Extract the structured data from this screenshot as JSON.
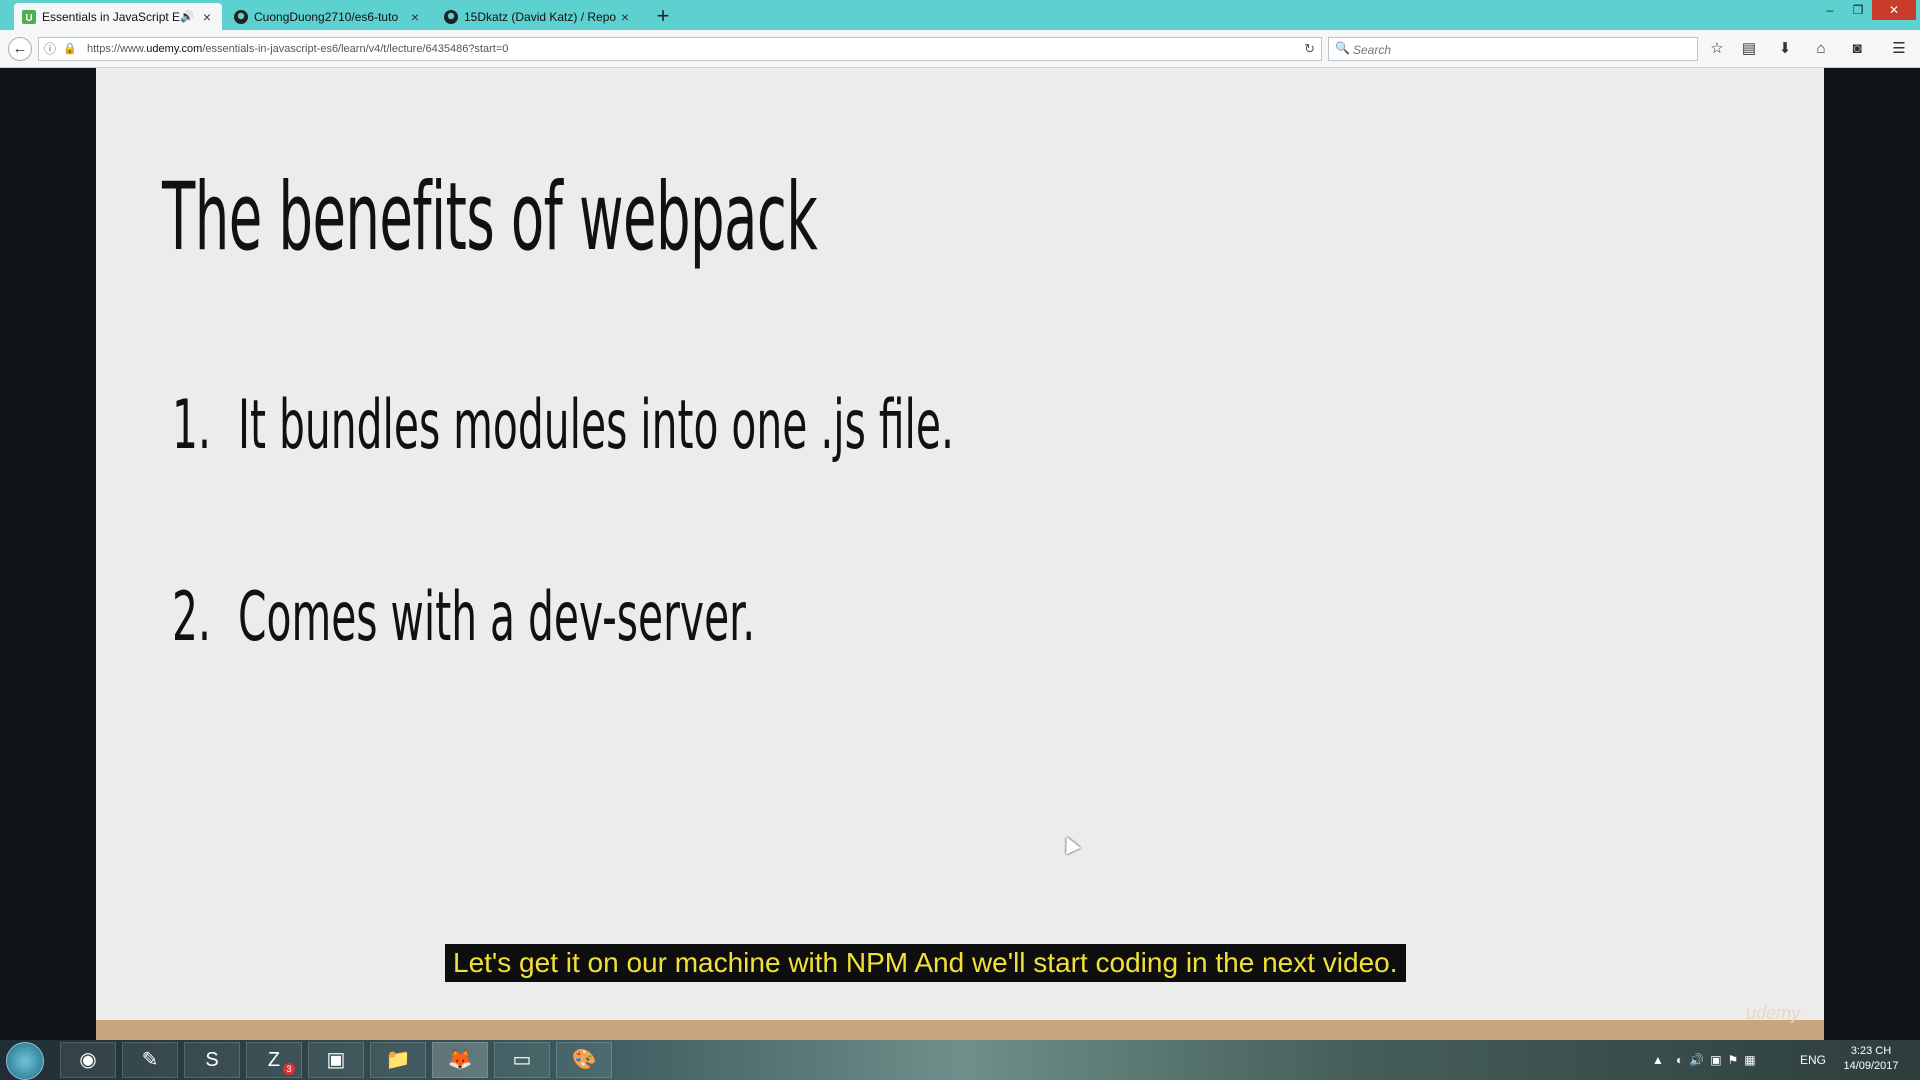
{
  "browser": {
    "tabs": [
      {
        "label": "Essentials in JavaScript ES",
        "active": true,
        "audio": true,
        "favicon": "udemy-icon"
      },
      {
        "label": "CuongDuong2710/es6-tuto",
        "active": false,
        "favicon": "github-icon"
      },
      {
        "label": "15Dkatz (David Katz) / Repo",
        "active": false,
        "favicon": "github-icon"
      }
    ],
    "url_prefix": "https://www.",
    "url_host": "udemy.com",
    "url_path": "/essentials-in-javascript-es6/learn/v4/t/lecture/6435486?start=0",
    "search_placeholder": "Search"
  },
  "slide": {
    "title": "The benefits of webpack",
    "items": [
      {
        "number": "1.",
        "text": "It bundles modules into one .js file."
      },
      {
        "number": "2.",
        "text": "Comes with a dev-server."
      }
    ],
    "watermark": "udemy"
  },
  "caption": "Let's get it on our machine with NPM And we'll start coding in the next video.",
  "taskbar": {
    "apps": [
      "chrome-icon",
      "notepad-icon",
      "skype-icon",
      "zalo-icon",
      "app-icon",
      "explorer-icon",
      "firefox-icon",
      "cmd-icon",
      "paint-icon"
    ],
    "zalo_badge": "3",
    "language": "ENG",
    "time": "3:23 CH",
    "date": "14/09/2017"
  },
  "colors": {
    "titlebar": "#5dd1cf",
    "caption_text": "#f0e03a",
    "slide_bg": "#ececec"
  }
}
